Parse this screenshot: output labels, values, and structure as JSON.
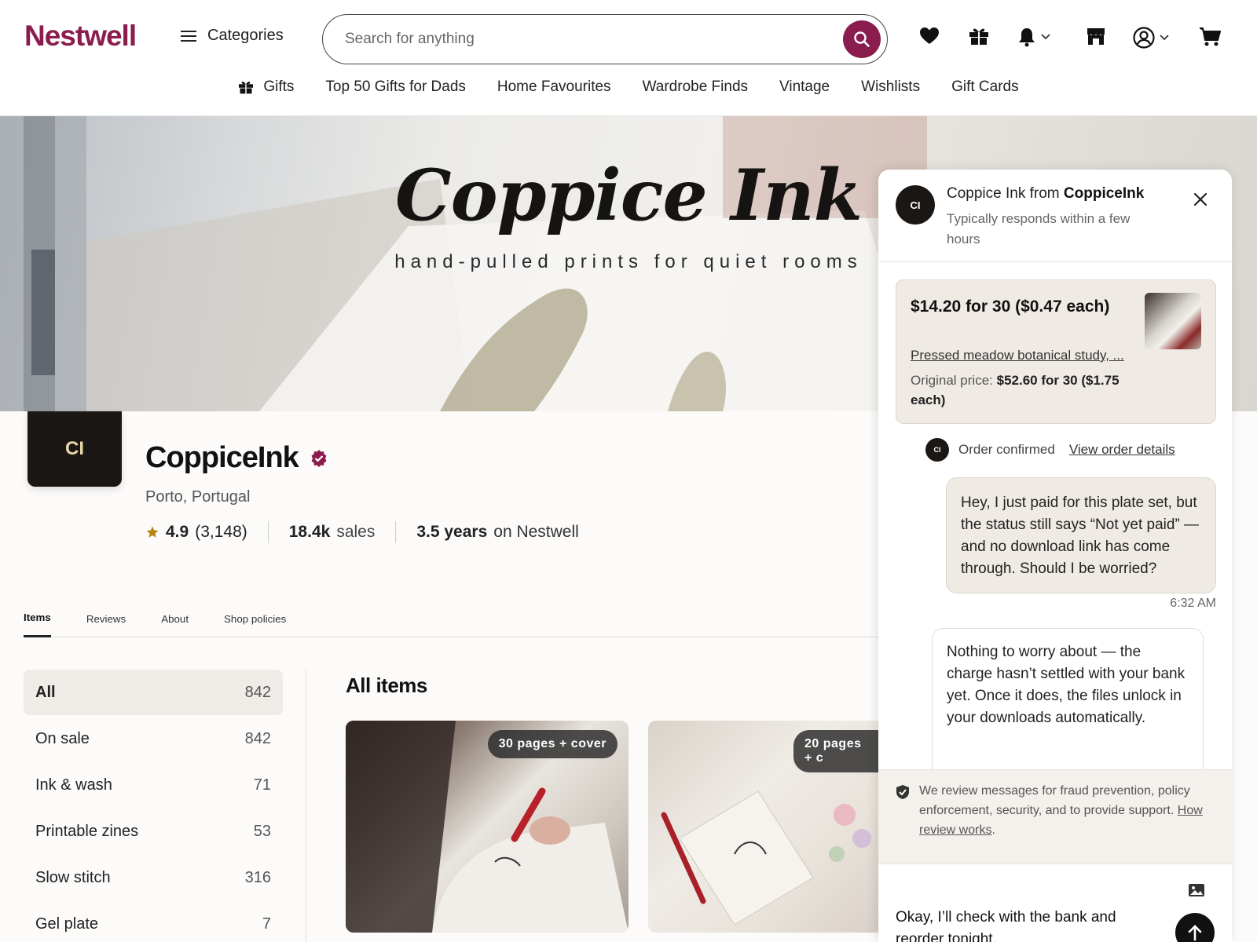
{
  "header": {
    "logo": "Nestwell",
    "categories_label": "Categories",
    "search_placeholder": "Search for anything",
    "icons": [
      "heart-icon",
      "gift-icon",
      "bell-icon",
      "shop-icon",
      "account-icon",
      "cart-icon"
    ]
  },
  "nav": {
    "gifts": "Gifts",
    "items": [
      "Top 50 Gifts for Dads",
      "Home Favourites",
      "Wardrobe Finds",
      "Vintage",
      "Wishlists",
      "Gift Cards"
    ]
  },
  "banner": {
    "title": "Coppice Ink",
    "tagline": "hand-pulled prints for quiet rooms"
  },
  "shop": {
    "logo_initials": "CI",
    "name": "CoppiceInk",
    "location": "Porto, Portugal",
    "rating": "4.9",
    "reviews": "(3,148)",
    "sales_value": "18.4k",
    "sales_label": "sales",
    "years_value": "3.5 years",
    "years_label": "on Nestwell"
  },
  "tabs": [
    "Items",
    "Reviews",
    "About",
    "Shop policies"
  ],
  "sections": [
    {
      "label": "All",
      "count": "842"
    },
    {
      "label": "On sale",
      "count": "842"
    },
    {
      "label": "Ink & wash",
      "count": "71"
    },
    {
      "label": "Printable zines",
      "count": "53"
    },
    {
      "label": "Slow stitch",
      "count": "316"
    },
    {
      "label": "Gel plate",
      "count": "7"
    }
  ],
  "items": {
    "title": "All items",
    "cards": [
      {
        "badge": "30 pages + cover"
      },
      {
        "badge": "20 pages + c"
      }
    ]
  },
  "chat": {
    "avatar_initials": "CI",
    "title_prefix": "Coppice Ink from ",
    "title_shop": "CoppiceInk",
    "subtitle": "Typically responds within a few hours",
    "offer": {
      "price": "$14.20 for 30 ($0.47 each)",
      "product": "Pressed meadow botanical study, ...",
      "original_label": "Original price: ",
      "original_value": "$52.60 for 30 ($1.75 each)"
    },
    "system": {
      "text": "Order confirmed",
      "link": "View order details"
    },
    "message_out": "Hey, I just paid for this plate set, but the status still says “Not yet paid” — and no download link has come through. Should I be worried?",
    "time": "6:32 AM",
    "message_in": "Nothing to worry about — the charge hasn’t settled with your bank yet. Once it does, the files unlock in your downloads automatically.",
    "notice_text": "We review messages for fraud prevention, policy enforcement, security, and to provide support. ",
    "notice_link": "How review works",
    "compose_text": "Okay, I’ll check with the bank and reorder tonight."
  }
}
